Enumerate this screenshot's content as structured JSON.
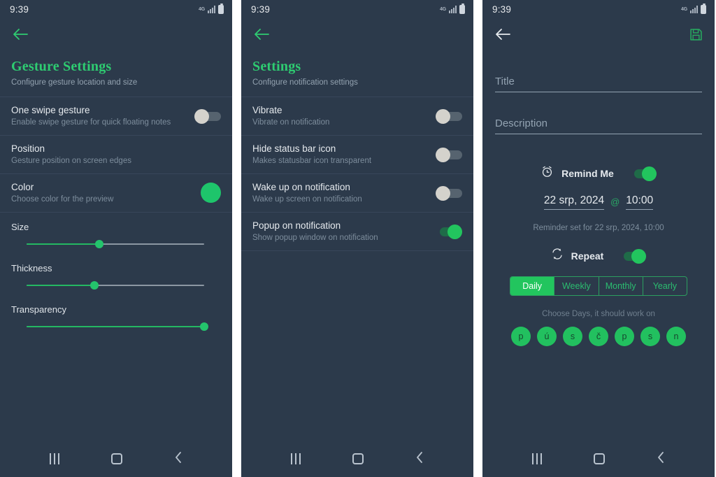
{
  "theme": {
    "background": "#2c3a4b",
    "accent": "#22c55e",
    "accent_dark": "#1f6b48",
    "title_color": "#2ecc71",
    "text_primary": "#e6eaee",
    "text_secondary": "#7d8d9c",
    "gap_color": "#ffffff"
  },
  "status_bar": {
    "time": "9:39",
    "network_icon": "4g-icon",
    "signal_icon": "signal-bars-icon",
    "battery_icon": "battery-icon"
  },
  "nav_bar": {
    "recents_icon": "recents-icon",
    "home_icon": "home-icon",
    "back_icon": "back-chevron-icon"
  },
  "panel1": {
    "back_icon": "back-arrow-icon",
    "title": "Gesture Settings",
    "subtitle": "Configure gesture location and size",
    "rows": [
      {
        "title": "One swipe gesture",
        "subtitle": "Enable swipe gesture for quick floating notes",
        "control": "toggle",
        "state": "off"
      },
      {
        "title": "Position",
        "subtitle": "Gesture position on screen edges",
        "control": "none",
        "state": ""
      },
      {
        "title": "Color",
        "subtitle": "Choose color for the preview",
        "control": "swatch",
        "state": "#1ec56b"
      }
    ],
    "sliders": [
      {
        "label": "Size",
        "value": 41
      },
      {
        "label": "Thickness",
        "value": 38
      },
      {
        "label": "Transparency",
        "value": 100
      }
    ]
  },
  "panel2": {
    "back_icon": "back-arrow-icon",
    "title": "Settings",
    "subtitle": "Configure notification settings",
    "rows": [
      {
        "title": "Vibrate",
        "subtitle": "Vibrate on notification",
        "control": "toggle",
        "state": "off"
      },
      {
        "title": "Hide status bar icon",
        "subtitle": "Makes statusbar icon transparent",
        "control": "toggle",
        "state": "off"
      },
      {
        "title": "Wake up on notification",
        "subtitle": "Wake up screen on notification",
        "control": "toggle",
        "state": "off"
      },
      {
        "title": "Popup on notification",
        "subtitle": "Show popup window on notification",
        "control": "toggle",
        "state": "on"
      }
    ]
  },
  "panel3": {
    "back_icon": "back-arrow-icon",
    "save_icon": "save-floppy-icon",
    "title_placeholder": "Title",
    "title_value": "",
    "description_placeholder": "Description",
    "description_value": "",
    "remind": {
      "icon": "alarm-clock-icon",
      "label": "Remind Me",
      "state": "on",
      "date": "22 srp, 2024",
      "separator": "@",
      "time": "10:00",
      "status": "Reminder set for 22 srp, 2024, 10:00"
    },
    "repeat": {
      "icon": "repeat-icon",
      "label": "Repeat",
      "state": "on",
      "options": [
        "Daily",
        "Weekly",
        "Monthly",
        "Yearly"
      ],
      "selected": "Daily",
      "days_hint": "Choose Days, it should work on",
      "days": [
        "p",
        "ú",
        "s",
        "č",
        "p",
        "s",
        "n"
      ]
    }
  }
}
